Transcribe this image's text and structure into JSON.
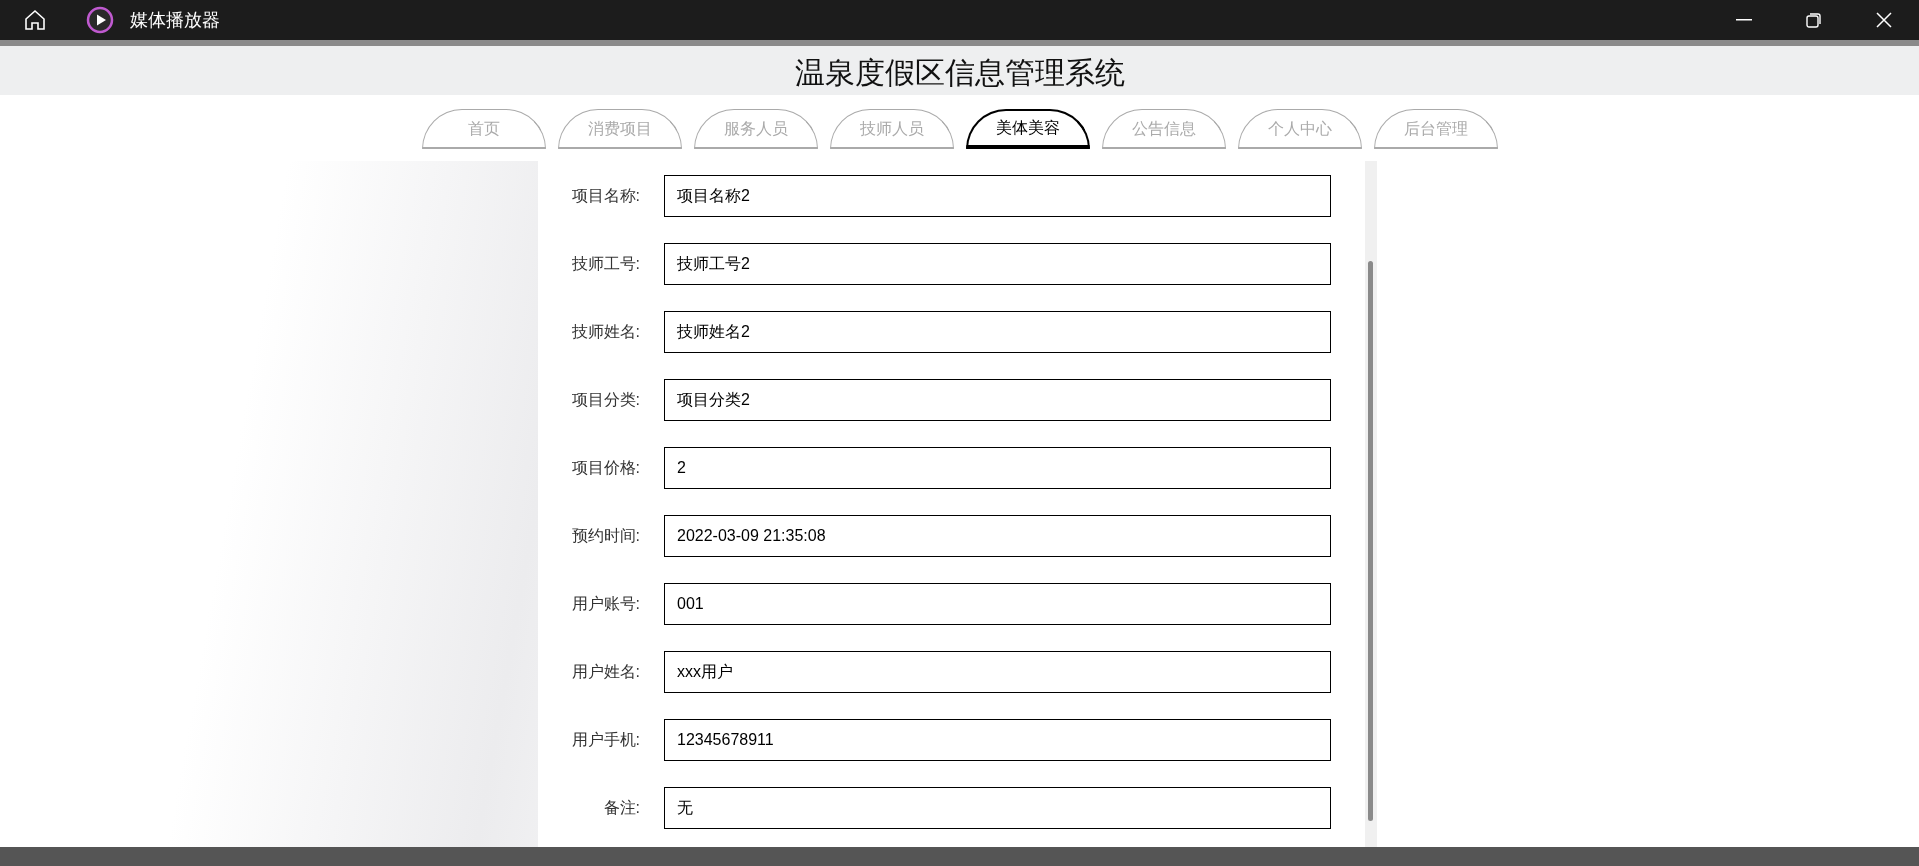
{
  "window": {
    "title": "媒体播放器"
  },
  "page": {
    "title": "温泉度假区信息管理系统"
  },
  "tabs": [
    {
      "label": "首页",
      "selected": false
    },
    {
      "label": "消费项目",
      "selected": false
    },
    {
      "label": "服务人员",
      "selected": false
    },
    {
      "label": "技师人员",
      "selected": false
    },
    {
      "label": "美体美容",
      "selected": true
    },
    {
      "label": "公告信息",
      "selected": false
    },
    {
      "label": "个人中心",
      "selected": false
    },
    {
      "label": "后台管理",
      "selected": false
    }
  ],
  "form": [
    {
      "label": "项目名称:",
      "value": "项目名称2"
    },
    {
      "label": "技师工号:",
      "value": "技师工号2"
    },
    {
      "label": "技师姓名:",
      "value": "技师姓名2"
    },
    {
      "label": "项目分类:",
      "value": "项目分类2"
    },
    {
      "label": "项目价格:",
      "value": "2"
    },
    {
      "label": "预约时间:",
      "value": "2022-03-09 21:35:08"
    },
    {
      "label": "用户账号:",
      "value": "001"
    },
    {
      "label": "用户姓名:",
      "value": "xxx用户"
    },
    {
      "label": "用户手机:",
      "value": "12345678911"
    },
    {
      "label": "备注:",
      "value": "无"
    }
  ]
}
